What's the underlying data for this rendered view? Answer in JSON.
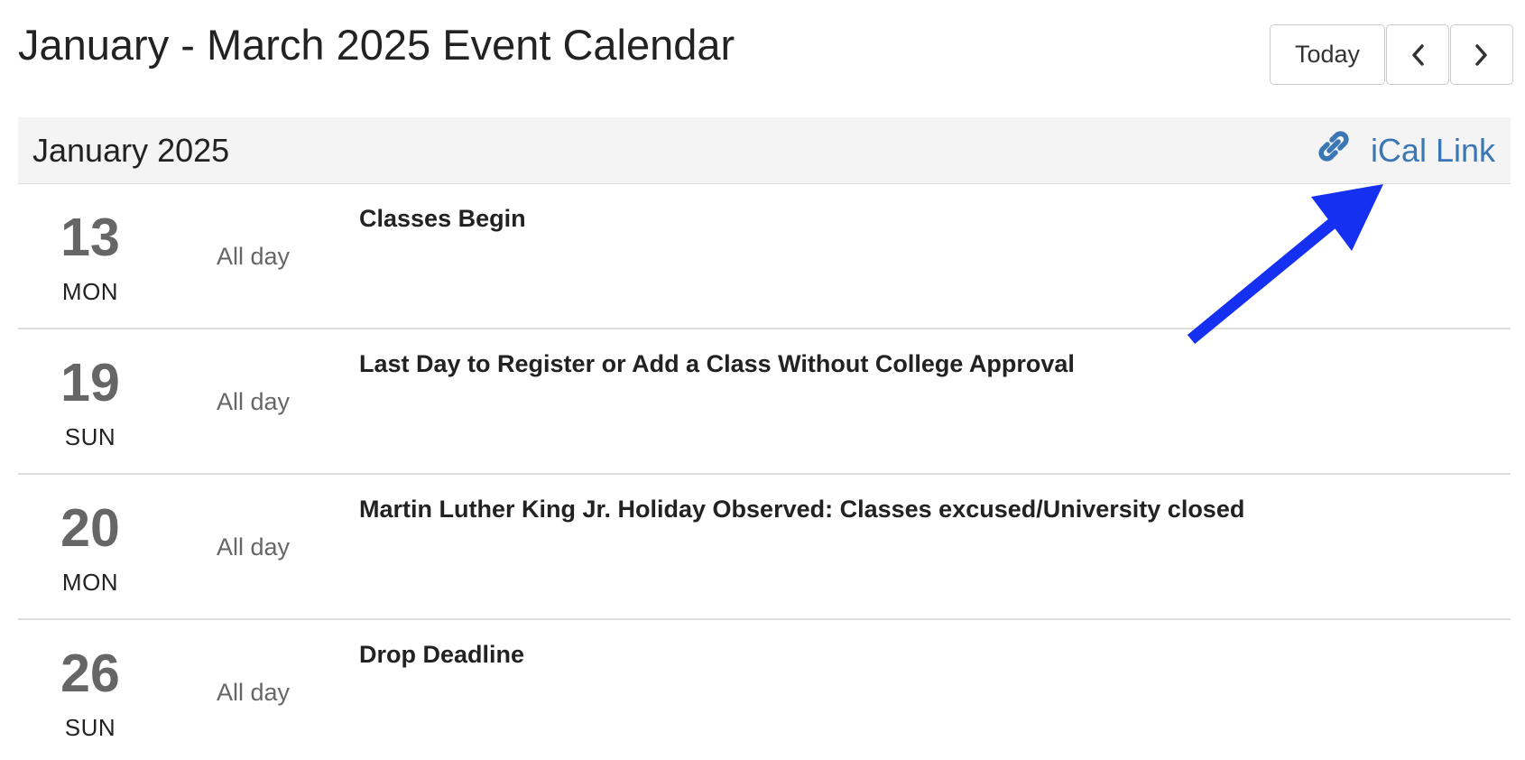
{
  "page": {
    "title": "January - March 2025 Event Calendar"
  },
  "nav": {
    "today_label": "Today",
    "prev_icon": "chevron-left-icon",
    "next_icon": "chevron-right-icon"
  },
  "month": {
    "title": "January 2025",
    "ical_label": "iCal Link",
    "ical_icon": "link-icon",
    "link_color": "#3a77b4"
  },
  "events": [
    {
      "day": "13",
      "weekday": "MON",
      "time": "All day",
      "title": "Classes Begin"
    },
    {
      "day": "19",
      "weekday": "SUN",
      "time": "All day",
      "title": "Last Day to Register or Add a Class Without College Approval"
    },
    {
      "day": "20",
      "weekday": "MON",
      "time": "All day",
      "title": "Martin Luther King Jr. Holiday Observed: Classes excused/University closed"
    },
    {
      "day": "26",
      "weekday": "SUN",
      "time": "All day",
      "title": "Drop Deadline"
    }
  ],
  "annotation": {
    "arrow_color": "#1530f0"
  }
}
